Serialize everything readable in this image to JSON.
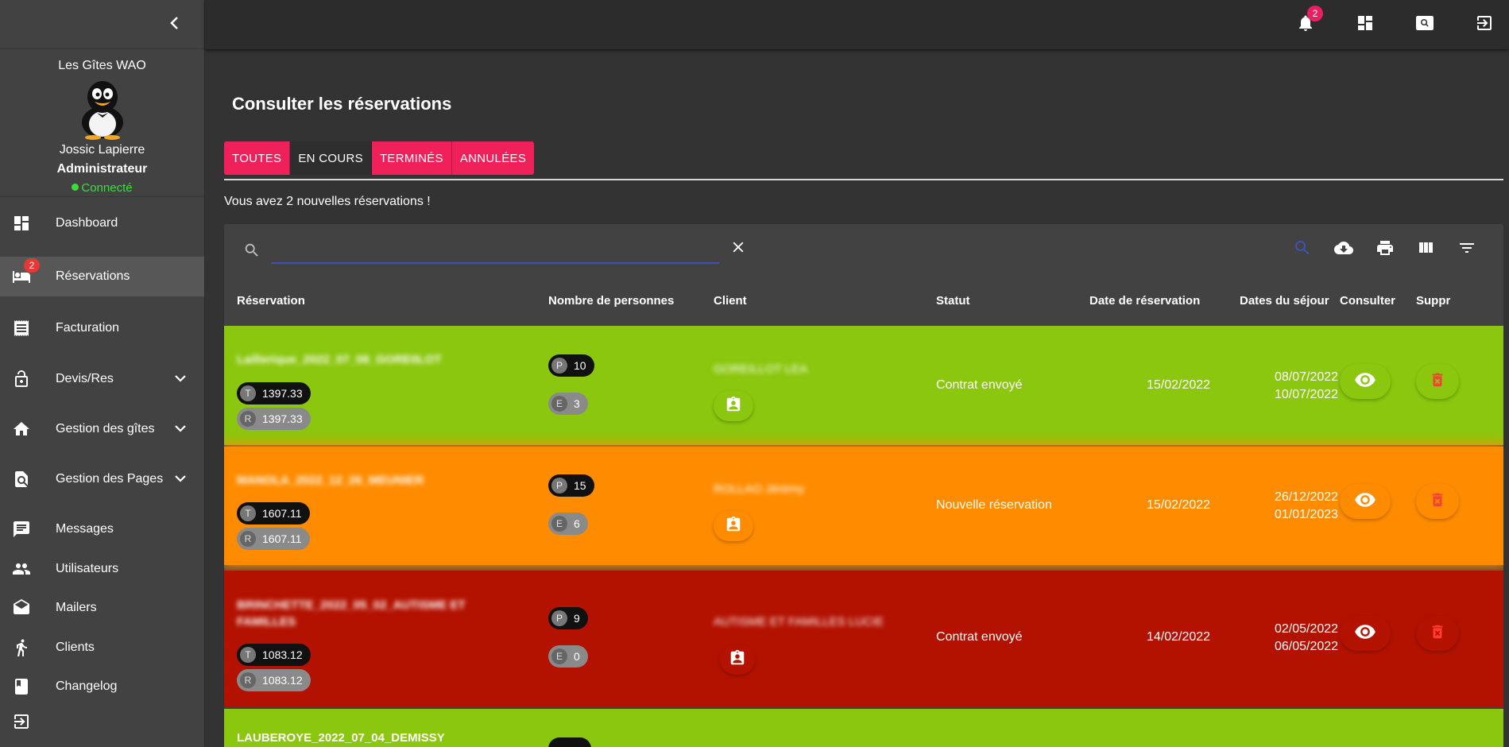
{
  "sidebar": {
    "site_name": "Les Gîtes WAO",
    "user_name": "Jossic Lapierre",
    "user_role": "Administrateur",
    "user_status": "Connecté",
    "items": [
      {
        "label": "Dashboard",
        "icon": "dashboard-icon"
      },
      {
        "label": "Réservations",
        "icon": "bed-icon",
        "badge": "2"
      },
      {
        "label": "Facturation",
        "icon": "receipt-icon"
      },
      {
        "label": "Devis/Res",
        "icon": "lock-open-icon"
      },
      {
        "label": "Gestion des gîtes",
        "icon": "home-icon"
      },
      {
        "label": "Gestion des Pages",
        "icon": "page-search-icon"
      },
      {
        "label": "Messages",
        "icon": "chat-icon"
      },
      {
        "label": "Utilisateurs",
        "icon": "people-icon"
      },
      {
        "label": "Mailers",
        "icon": "mail-open-icon"
      },
      {
        "label": "Clients",
        "icon": "walking-person-icon"
      },
      {
        "label": "Changelog",
        "icon": "book-icon"
      }
    ]
  },
  "topbar": {
    "notification_count": "2"
  },
  "main": {
    "title": "Consulter les réservations",
    "tabs": [
      "TOUTES",
      "EN COURS",
      "TERMINÉS",
      "ANNULÉES"
    ],
    "active_tab": "EN COURS",
    "notice": "Vous avez 2 nouvelles réservations !",
    "search": {
      "value": "",
      "placeholder": ""
    }
  },
  "table": {
    "headers": [
      "Réservation",
      "Nombre de personnes",
      "Client",
      "Statut",
      "Date de réservation",
      "Dates du séjour",
      "Consulter",
      "Suppr"
    ],
    "rows": [
      {
        "color": "#8bc70e",
        "reservation": "Laillerique_2022_07_08_GOREIILOT",
        "total_letter": "T",
        "total": "1397.33",
        "rest_letter": "R",
        "rest": "1397.33",
        "p_letter": "P",
        "persons": "10",
        "e_letter": "E",
        "children": "3",
        "client": "GOREILLOT LEA",
        "status": "Contrat envoyé",
        "date_reservation": "15/02/2022",
        "stay_start": "08/07/2022",
        "stay_end": "10/07/2022"
      },
      {
        "color": "#ff8c00",
        "reservation": "MANOLA_2022_12_26_MEUNIER",
        "total_letter": "T",
        "total": "1607.11",
        "rest_letter": "R",
        "rest": "1607.11",
        "p_letter": "P",
        "persons": "15",
        "e_letter": "E",
        "children": "6",
        "client": "ROLLAO Jérémy",
        "status": "Nouvelle réservation",
        "date_reservation": "15/02/2022",
        "stay_start": "26/12/2022",
        "stay_end": "01/01/2023"
      },
      {
        "color": "#b31200",
        "reservation_line1": "BRINCHETTE_2022_05_02_AUTISME ET",
        "reservation_line2": "FAMILLES",
        "total_letter": "T",
        "total": "1083.12",
        "rest_letter": "R",
        "rest": "1083.12",
        "p_letter": "P",
        "persons": "9",
        "e_letter": "E",
        "children": "0",
        "client": "AUTISME ET FAMILLES LUCIE",
        "status": "Contrat envoyé",
        "date_reservation": "14/02/2022",
        "stay_start": "02/05/2022",
        "stay_end": "06/05/2022"
      },
      {
        "color": "#8bc70e",
        "reservation": "LAUBEROYE_2022_07_04_DEMISSY"
      }
    ]
  },
  "colors": {
    "accent": "#f0205b",
    "row_green": "#8bc70e",
    "row_orange": "#ff8c00",
    "row_red": "#b31200",
    "connected": "#3ddc3d"
  }
}
